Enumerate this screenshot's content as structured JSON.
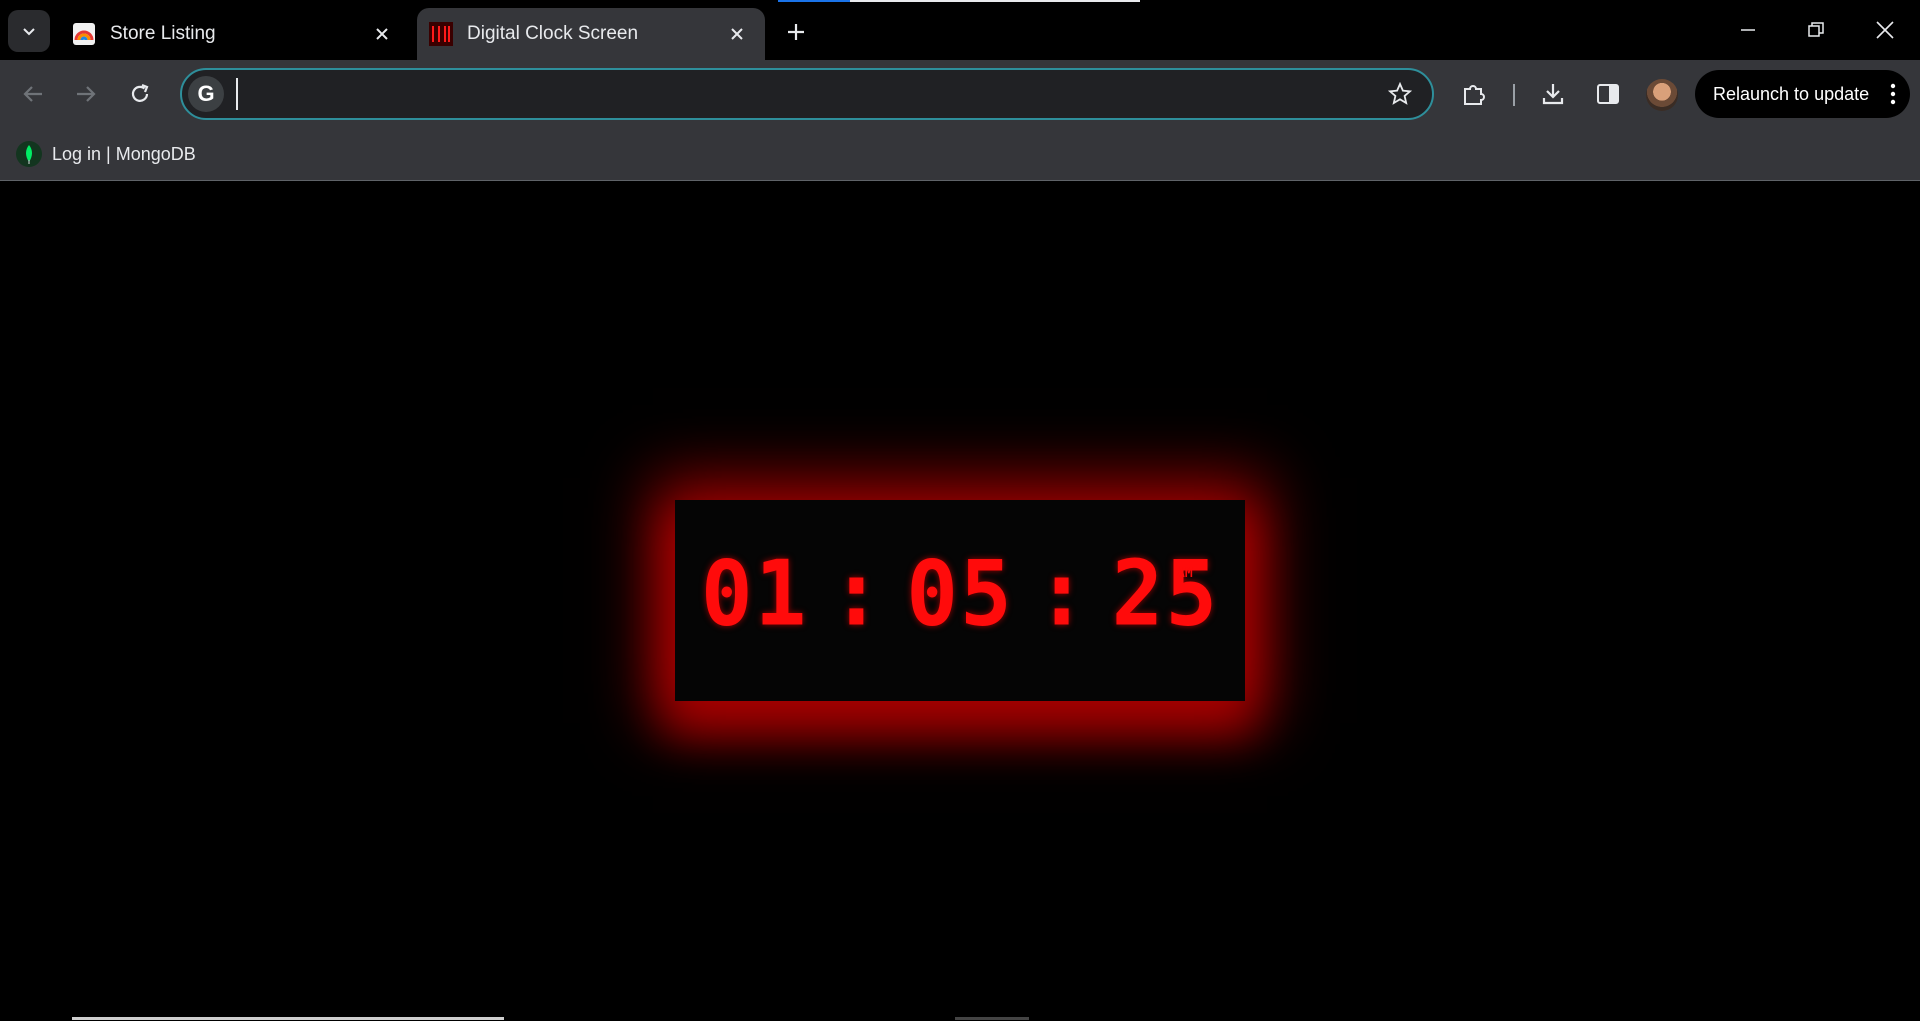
{
  "tabs": [
    {
      "title": "Store Listing",
      "icon": "rainbow-store-icon",
      "active": false
    },
    {
      "title": "Digital Clock Screen",
      "icon": "digital-clock-favicon",
      "active": true
    }
  ],
  "omnibox": {
    "value": "",
    "placeholder": ""
  },
  "toolbar": {
    "relaunch_label": "Relaunch to update"
  },
  "bookmarks": [
    {
      "label": "Log in | MongoDB",
      "icon": "mongodb-leaf-icon"
    }
  ],
  "clock": {
    "hours": "01",
    "minutes": "05",
    "seconds": "25",
    "separator": ":",
    "period": "AM",
    "color": "#ff0b0b",
    "glow": "#c80000"
  },
  "colors": {
    "omnibox_border": "#2e8f9b",
    "toolbar_bg": "#35363a",
    "page_bg": "#000000",
    "load_progress": "#1a73e8"
  }
}
